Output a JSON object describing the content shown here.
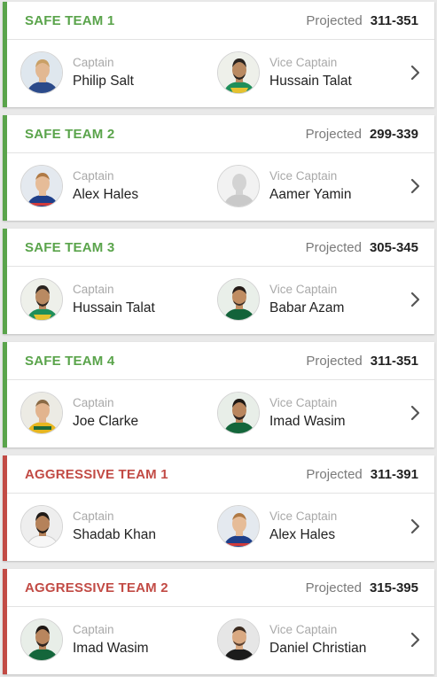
{
  "projected_label": "Projected",
  "role_labels": {
    "captain": "Captain",
    "vice_captain": "Vice Captain"
  },
  "teams": [
    {
      "name": "SAFE TEAM 1",
      "type": "safe",
      "range": "311-351",
      "captain": {
        "name": "Philip Salt",
        "avatar": "player-photo"
      },
      "vice_captain": {
        "name": "Hussain Talat",
        "avatar": "player-photo"
      }
    },
    {
      "name": "SAFE TEAM 2",
      "type": "safe",
      "range": "299-339",
      "captain": {
        "name": "Alex Hales",
        "avatar": "player-photo"
      },
      "vice_captain": {
        "name": "Aamer Yamin",
        "avatar": "placeholder-silhouette"
      }
    },
    {
      "name": "SAFE TEAM 3",
      "type": "safe",
      "range": "305-345",
      "captain": {
        "name": "Hussain Talat",
        "avatar": "player-photo"
      },
      "vice_captain": {
        "name": "Babar Azam",
        "avatar": "player-photo"
      }
    },
    {
      "name": "SAFE TEAM 4",
      "type": "safe",
      "range": "311-351",
      "captain": {
        "name": "Joe Clarke",
        "avatar": "player-photo"
      },
      "vice_captain": {
        "name": "Imad Wasim",
        "avatar": "player-photo"
      }
    },
    {
      "name": "AGGRESSIVE TEAM 1",
      "type": "aggressive",
      "range": "311-391",
      "captain": {
        "name": "Shadab Khan",
        "avatar": "player-photo"
      },
      "vice_captain": {
        "name": "Alex Hales",
        "avatar": "player-photo"
      }
    },
    {
      "name": "AGGRESSIVE TEAM 2",
      "type": "aggressive",
      "range": "315-395",
      "captain": {
        "name": "Imad Wasim",
        "avatar": "player-photo"
      },
      "vice_captain": {
        "name": "Daniel Christian",
        "avatar": "player-photo"
      }
    }
  ],
  "colors": {
    "safe": "#5aa44b",
    "aggressive": "#c24b45",
    "background": "#e9e9e9",
    "projected_label": "#7a7a7a",
    "role_label": "#a9a9a9"
  },
  "icons": {
    "row_action": "chevron-right-icon"
  }
}
